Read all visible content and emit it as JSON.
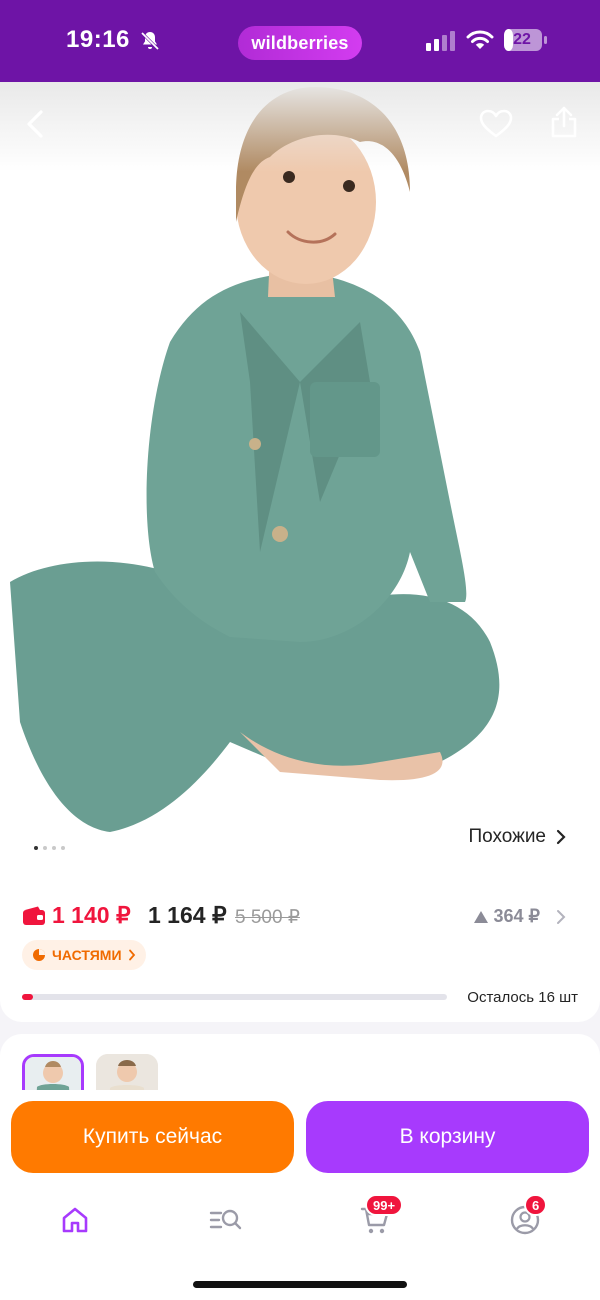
{
  "status_bar": {
    "time": "19:16",
    "brand": "wildberries",
    "battery": "22"
  },
  "gallery": {
    "similar_label": "Похожие",
    "current_photo": 1,
    "photo_count": 4
  },
  "price": {
    "wallet_price": "1 140 ₽",
    "price": "1 164 ₽",
    "old_price": "5 500 ₽",
    "delta": "364 ₽",
    "installment_label": "ЧАСТЯМИ"
  },
  "stock": {
    "remaining_label": "Осталось 16 шт",
    "progress_fraction": 0.025
  },
  "actions": {
    "buy_now": "Купить сейчас",
    "add_to_cart": "В корзину"
  },
  "tabbar": {
    "cart_badge": "99+",
    "profile_badge": "6"
  },
  "colors": {
    "brand": "#6e14a6",
    "accent_purple": "#a73afd",
    "orange": "#ff7a00",
    "sale_red": "#f0153d",
    "garment": "#6a9e92"
  },
  "icons": [
    "bell-off-icon",
    "signal-icon",
    "wifi-icon",
    "battery-icon",
    "back-icon",
    "heart-icon",
    "share-icon",
    "wallet-icon",
    "chevron-right-icon",
    "pie-icon",
    "home-icon",
    "catalog-search-icon",
    "cart-icon",
    "profile-icon"
  ]
}
